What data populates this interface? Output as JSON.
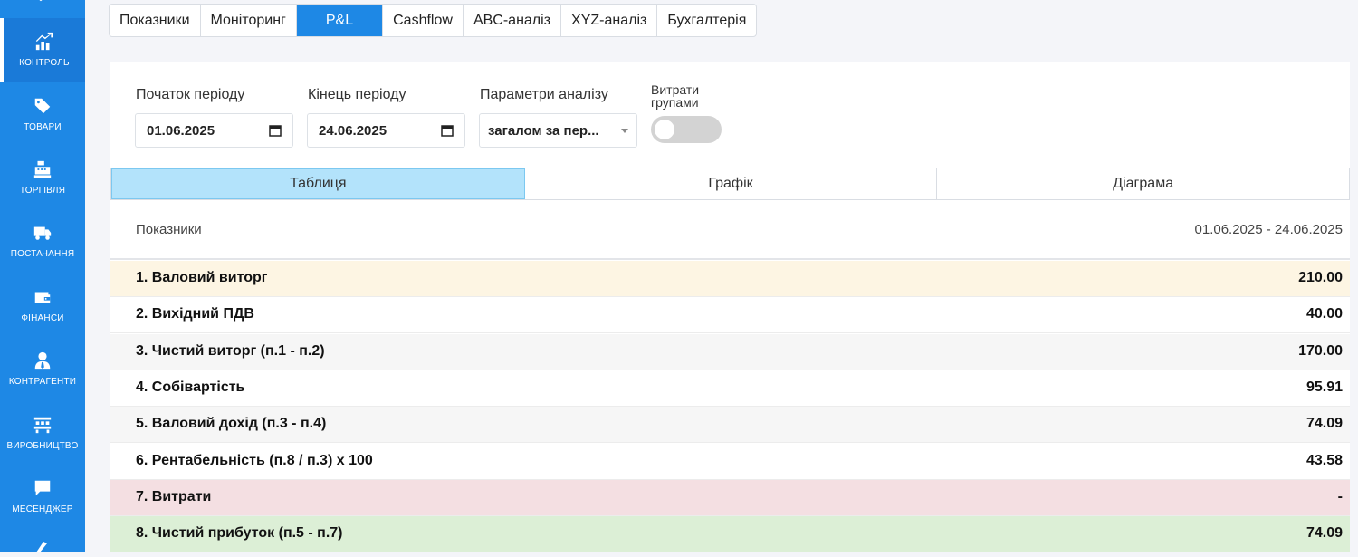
{
  "sidebar": {
    "items": [
      {
        "label": "Контроль",
        "icon": "chart-growth-icon"
      },
      {
        "label": "Товари",
        "icon": "tags-icon"
      },
      {
        "label": "Торгівля",
        "icon": "cash-register-icon"
      },
      {
        "label": "Постачання",
        "icon": "truck-icon"
      },
      {
        "label": "Фінанси",
        "icon": "wallet-icon"
      },
      {
        "label": "Контрагенти",
        "icon": "user-tie-icon"
      },
      {
        "label": "Виробництво",
        "icon": "factory-icon"
      },
      {
        "label": "Месенджер",
        "icon": "chat-icon"
      }
    ],
    "active_index": 0
  },
  "top_tabs": [
    "Показники",
    "Моніторинг",
    "P&L",
    "Cashflow",
    "ABC-аналіз",
    "XYZ-аналіз",
    "Бухгалтерія"
  ],
  "top_tabs_active": 2,
  "filters": {
    "start_label": "Початок періоду",
    "start_value": "01.06.2025",
    "end_label": "Кінець періоду",
    "end_value": "24.06.2025",
    "params_label": "Параметри аналізу",
    "params_value": "загалом за пер...",
    "toggle_label_line1": "Витрати",
    "toggle_label_line2": "групами",
    "toggle_on": false
  },
  "view_tabs": [
    "Таблиця",
    "Графік",
    "Діаграма"
  ],
  "view_tabs_active": 0,
  "table": {
    "header_left": "Показники",
    "header_right": "01.06.2025 - 24.06.2025",
    "rows": [
      {
        "label": "1. Валовий виторг",
        "value": "210.00",
        "bg": "#fdf5e3"
      },
      {
        "label": "2. Вихідний ПДВ",
        "value": "40.00",
        "bg": "#ffffff"
      },
      {
        "label": "3. Чистий виторг (п.1 - п.2)",
        "value": "170.00",
        "bg": "#f6f6f6"
      },
      {
        "label": "4. Собівартість",
        "value": "95.91",
        "bg": "#ffffff"
      },
      {
        "label": "5. Валовий дохід (п.3 - п.4)",
        "value": "74.09",
        "bg": "#f6f6f6"
      },
      {
        "label": "6. Рентабельність (п.8 / п.3) x 100",
        "value": "43.58",
        "bg": "#ffffff"
      },
      {
        "label": "7. Витрати",
        "value": "-",
        "bg": "#f4dfe2"
      },
      {
        "label": "8. Чистий прибуток (п.5 - п.7)",
        "value": "74.09",
        "bg": "#dcefd6"
      }
    ]
  },
  "colors": {
    "sidebar": "#1e88e5",
    "active_tab": "#1e88e5",
    "active_view_tab": "#b3e3fb"
  }
}
